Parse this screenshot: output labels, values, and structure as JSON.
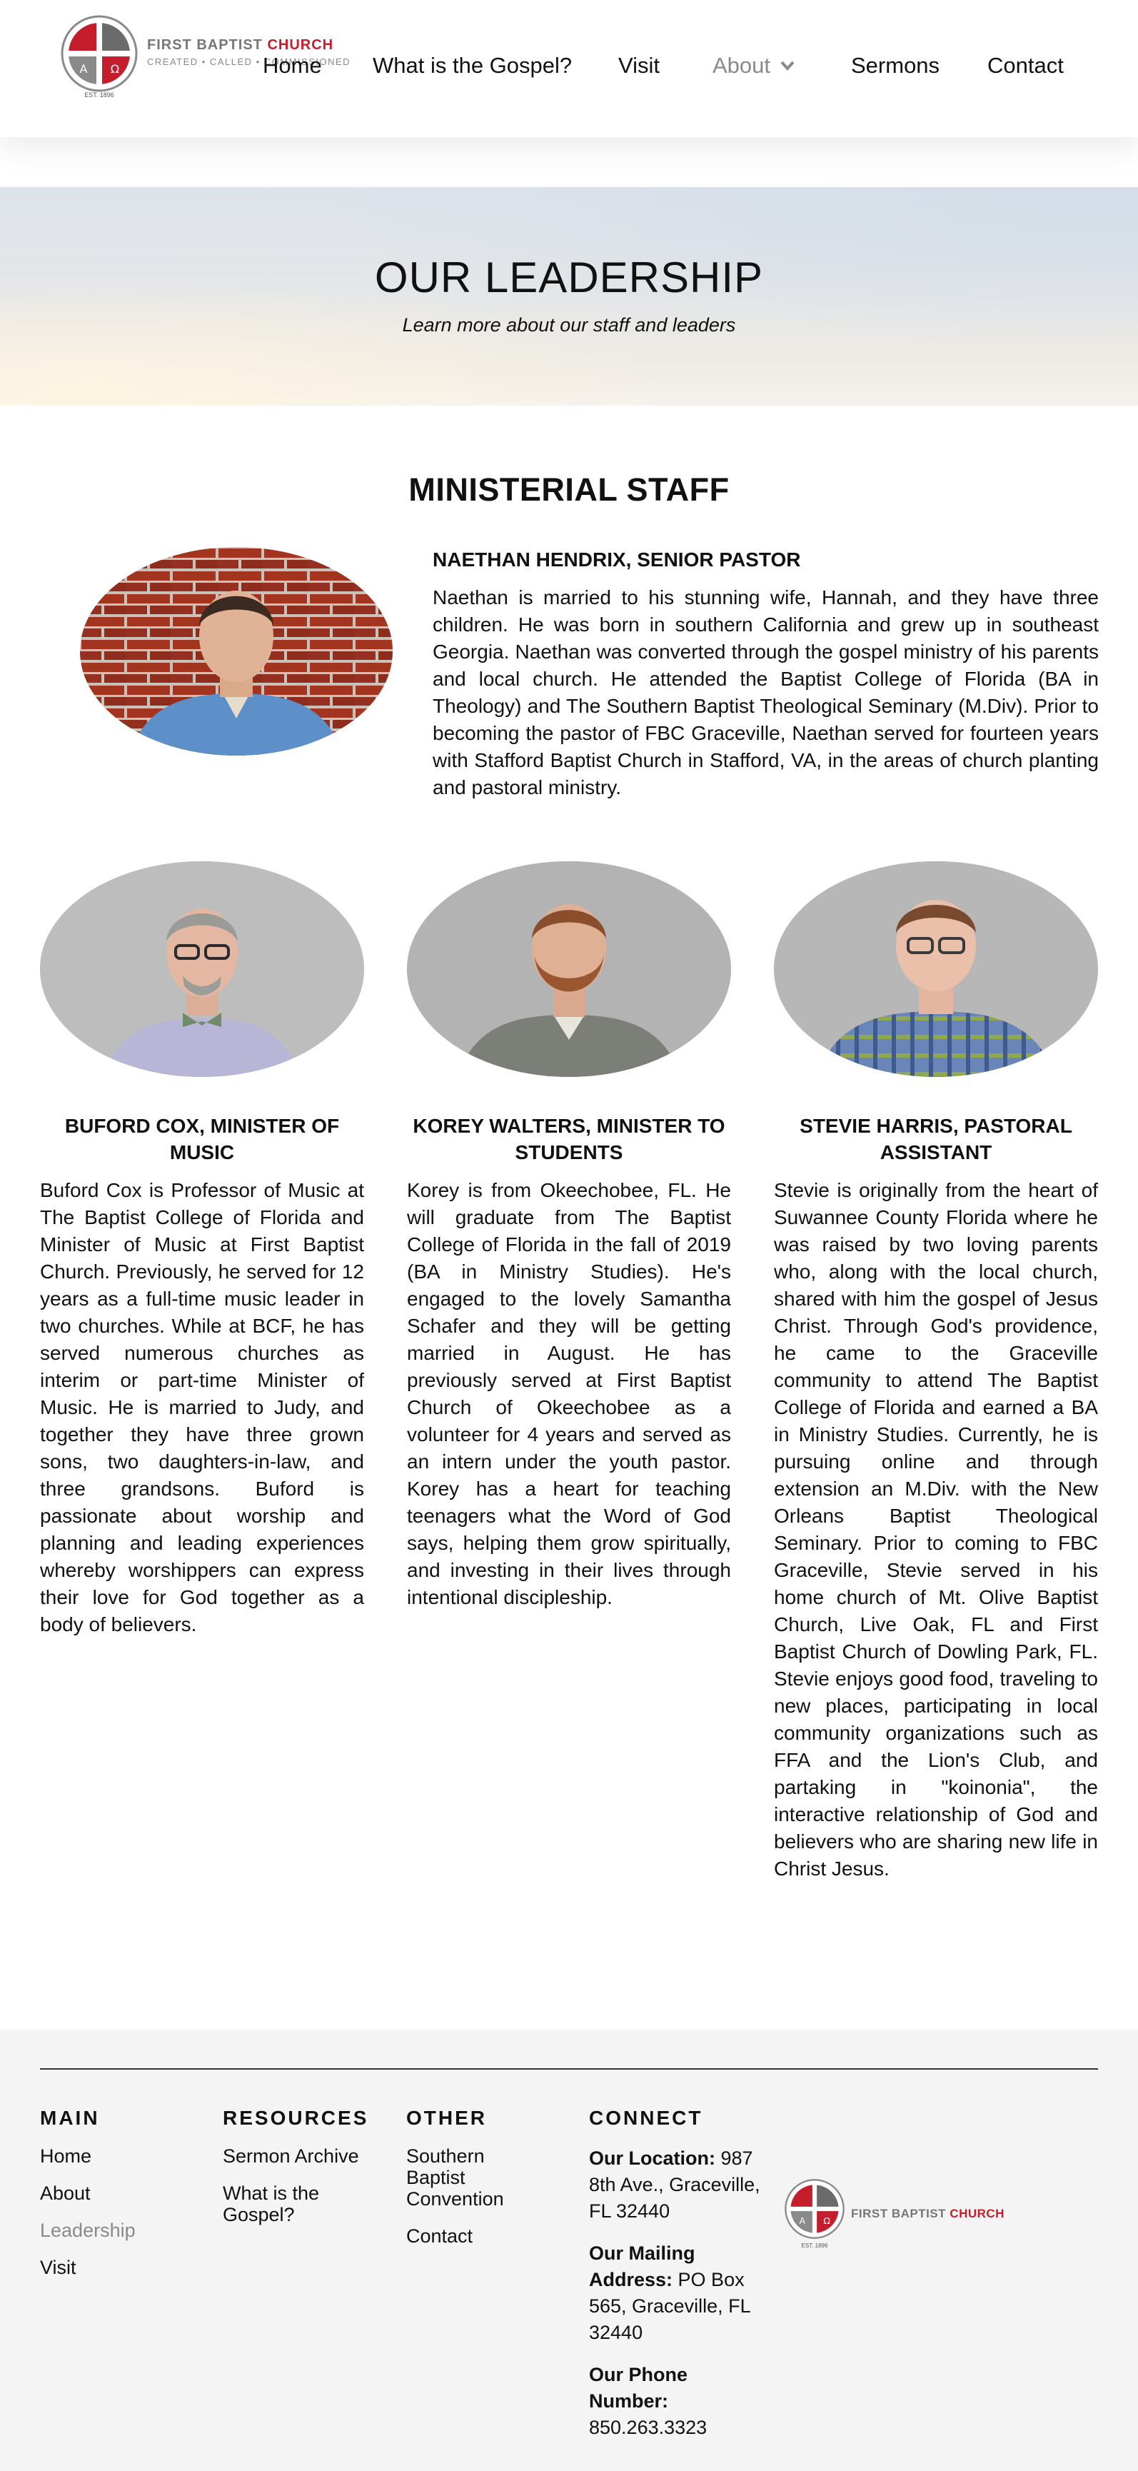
{
  "brand": {
    "name_part1": "FIRST BAPTIST",
    "name_part2": "CHURCH",
    "tagline": "CREATED • CALLED • COMMISSIONED",
    "est": "EST. 1896",
    "alpha": "A",
    "omega": "Ω",
    "colors": {
      "red": "#c41e2c",
      "gray": "#777777"
    }
  },
  "nav": {
    "items": [
      {
        "label": "Home"
      },
      {
        "label": "What is the Gospel?"
      },
      {
        "label": "Visit"
      },
      {
        "label": "About",
        "active": true
      },
      {
        "label": "Sermons"
      },
      {
        "label": "Contact"
      }
    ],
    "dropdown_icon": "chevron-down-icon"
  },
  "hero": {
    "title": "OUR LEADERSHIP",
    "subtitle": "Learn more about our staff and leaders"
  },
  "section": {
    "title": "MINISTERIAL STAFF"
  },
  "lead": {
    "name": "NAETHAN HENDRIX, SENIOR PASTOR",
    "bio": "Naethan is married to his stunning wife, Hannah, and they have three children. He was born in southern California and grew up in southeast Georgia. Naethan was converted through the gospel ministry of his parents and local church. He attended the Baptist College of Florida (BA in Theology) and The Southern Baptist Theological Seminary (M.Div). Prior to becoming the pastor of FBC Graceville, Naethan served for fourteen years with Stafford Baptist Church in Stafford, VA, in the areas of church planting and pastoral ministry."
  },
  "staff": [
    {
      "name": "BUFORD COX, MINISTER OF MUSIC",
      "bio": "Buford Cox is Professor of Music at The Baptist College of Florida and Minister of Music at First Baptist Church. Previously, he served for 12 years as a full-time music leader in two churches. While at BCF, he has served numerous churches as interim or part-time Minister of Music. He is married to Judy, and together they have three grown sons, two daughters-in-law, and three grandsons. Buford is passionate about worship and planning and leading experiences whereby worshippers can express their love for God together as a body of believers."
    },
    {
      "name": "KOREY WALTERS, MINISTER TO STUDENTS",
      "bio": "Korey is from Okeechobee, FL. He will graduate from The Baptist College of Florida in the fall of 2019 (BA in Ministry Studies). He's engaged to the lovely Samantha Schafer and they will be getting married in August. He has previously served at First Baptist Church of Okeechobee as a volunteer for 4 years and served as an intern under the youth pastor. Korey has a heart for teaching teenagers what the Word of God says, helping them grow spiritually, and investing in their lives through intentional discipleship."
    },
    {
      "name": "STEVIE HARRIS, PASTORAL ASSISTANT",
      "bio": "Stevie is originally from the heart of Suwannee County Florida where he was raised by two loving parents who, along with the local church, shared with him the gospel of Jesus Christ. Through God's providence, he came to the Graceville community to attend The Baptist College of Florida and earned a BA in Ministry Studies. Currently, he is pursuing online and through extension an M.Div. with the New Orleans Baptist Theological Seminary. Prior to coming to FBC Graceville, Stevie served in his home church of Mt. Olive Baptist Church, Live Oak, FL and First Baptist Church of Dowling Park, FL. Stevie enjoys good food, traveling to new places, participating in local community organizations such as FFA and the Lion's Club, and partaking in \"koinonia\", the interactive relationship of God and believers who are sharing new life in Christ Jesus."
    }
  ],
  "footer": {
    "main": {
      "heading": "MAIN",
      "links": [
        {
          "label": "Home"
        },
        {
          "label": "About"
        },
        {
          "label": "Leadership",
          "active": true
        },
        {
          "label": "Visit"
        }
      ]
    },
    "resources": {
      "heading": "RESOURCES",
      "links": [
        {
          "label": "Sermon Archive"
        },
        {
          "label": "What is the Gospel?"
        }
      ]
    },
    "other": {
      "heading": "OTHER",
      "links": [
        {
          "label": "Southern Baptist Convention"
        },
        {
          "label": "Contact"
        }
      ]
    },
    "connect": {
      "heading": "CONNECT",
      "location_label": "Our Location:",
      "location": "987 8th Ave., Graceville, FL 32440",
      "mailing_label": "Our Mailing Address:",
      "mailing": "PO Box 565, Graceville, FL 32440",
      "phone_label": "Our Phone Number:",
      "phone": "850.263.3323"
    }
  }
}
